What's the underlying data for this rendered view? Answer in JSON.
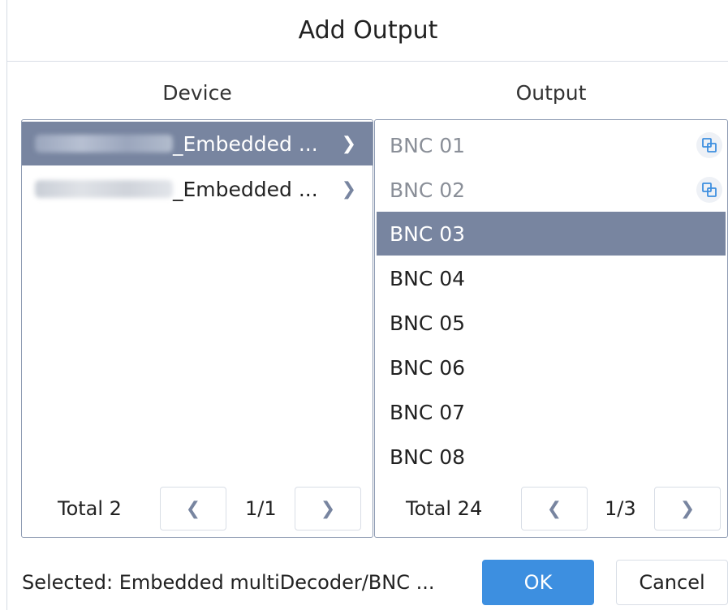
{
  "dialog": {
    "title": "Add Output",
    "device_header": "Device",
    "output_header": "Output",
    "selected_text": "Selected: Embedded multiDecoder/BNC ...",
    "ok_label": "OK",
    "cancel_label": "Cancel"
  },
  "devices": {
    "items": [
      {
        "suffix": "_Embedded ...",
        "selected": true
      },
      {
        "suffix": "_Embedded ...",
        "selected": false
      }
    ],
    "total": "Total 2",
    "page": "1/1"
  },
  "outputs": {
    "items": [
      {
        "label": "BNC 01",
        "state": "disabled",
        "has_icon": true
      },
      {
        "label": "BNC 02",
        "state": "disabled",
        "has_icon": true
      },
      {
        "label": "BNC 03",
        "state": "selected"
      },
      {
        "label": "BNC 04",
        "state": "normal"
      },
      {
        "label": "BNC 05",
        "state": "normal"
      },
      {
        "label": "BNC 06",
        "state": "normal"
      },
      {
        "label": "BNC 07",
        "state": "normal"
      },
      {
        "label": "BNC 08",
        "state": "normal"
      }
    ],
    "total": "Total 24",
    "page": "1/3"
  },
  "icons": {
    "prev": "chevron-left-icon",
    "next": "chevron-right-icon",
    "item_arrow": "chevron-right-icon",
    "linked": "copy-link-icon"
  },
  "colors": {
    "selected_row": "#7885a0",
    "primary_button": "#3d8fe0",
    "panel_border": "#8f9cb3",
    "disabled_text": "#8a8f98"
  }
}
